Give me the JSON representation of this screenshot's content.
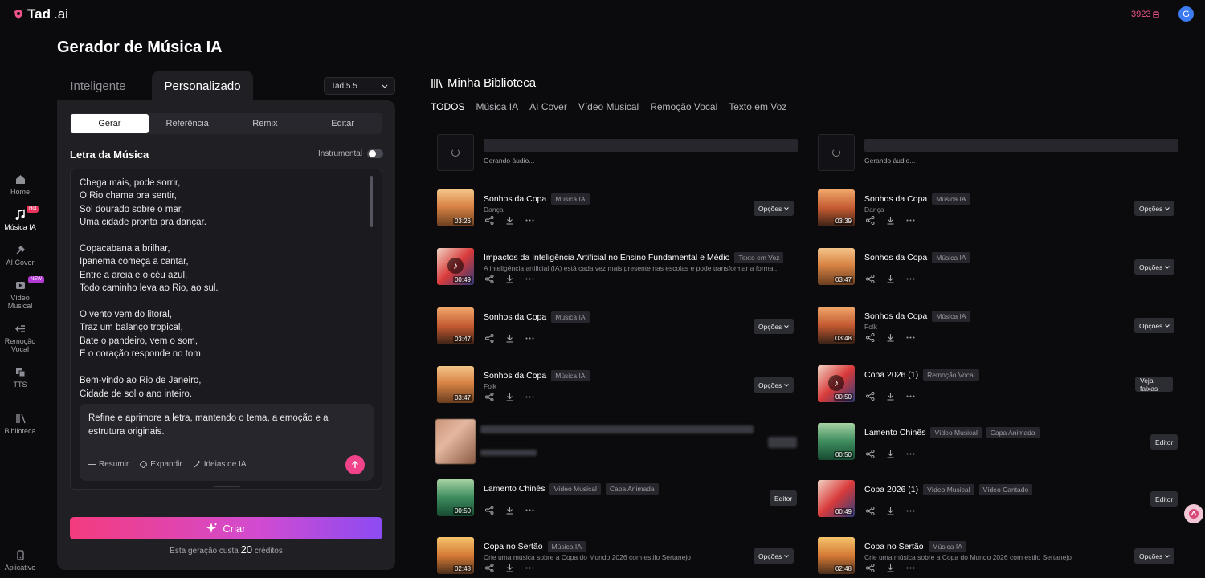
{
  "brand": {
    "name": "Tad",
    "suffix": ".ai"
  },
  "header": {
    "credits": "3923",
    "avatar_initial": "G"
  },
  "sidebar": {
    "items": [
      {
        "label": "Home",
        "icon": "home-icon"
      },
      {
        "label": "Música IA",
        "icon": "music-note-icon",
        "badge": "Hot"
      },
      {
        "label": "AI Cover",
        "icon": "ai-cover-icon"
      },
      {
        "label": "Vídeo Musical",
        "icon": "video-icon",
        "badge": "NEW"
      },
      {
        "label": "Remoção Vocal",
        "icon": "vocal-removal-icon"
      },
      {
        "label": "TTS",
        "icon": "tts-icon"
      },
      {
        "label": "Biblioteca",
        "icon": "library-icon"
      }
    ],
    "bottom": {
      "label": "Aplicativo",
      "icon": "phone-icon"
    }
  },
  "page": {
    "title": "Gerador de Música IA"
  },
  "generator": {
    "mode_tabs": [
      "Inteligente",
      "Personalizado"
    ],
    "model": "Tad 5.5",
    "sub_tabs": [
      "Gerar",
      "Referência",
      "Remix",
      "Editar"
    ],
    "lyrics_label": "Letra da Música",
    "instrumental_label": "Instrumental",
    "lyrics": "Chega mais, pode sorrir,\nO Rio chama pra sentir,\nSol dourado sobre o mar,\nUma cidade pronta pra dançar.\n\nCopacabana a brilhar,\nIpanema começa a cantar,\nEntre a areia e o céu azul,\nTodo caminho leva ao Rio, ao sul.\n\nO vento vem do litoral,\nTraz um balanço tropical,\nBate o pandeiro, vem o som,\nE o coração responde no tom.\n\nBem-vindo ao Rio de Janeiro,\nCidade de sol o ano inteiro.",
    "refine_text": "Refine e aprimore a letra, mantendo o tema, a emoção e a estrutura originais.",
    "refine_actions": [
      "Resumir",
      "Expandir",
      "Ideias de IA"
    ],
    "create_label": "Criar",
    "cost_prefix": "Esta geração custa",
    "cost_value": "20",
    "cost_suffix": "créditos"
  },
  "library": {
    "title": "Minha Biblioteca",
    "tabs": [
      "TODOS",
      "Música IA",
      "AI Cover",
      "Vídeo Musical",
      "Remoção Vocal",
      "Texto em Voz"
    ],
    "generating_text": "Gerando áudio...",
    "left": [
      {
        "title": "Sonhos da Copa",
        "tags": [
          "Música IA"
        ],
        "sub": "Dança",
        "duration": "03:26",
        "action": "Opções"
      },
      {
        "title": "Impactos da Inteligência Artificial no Ensino Fundamental e Médio",
        "tags": [
          "Texto em Voz"
        ],
        "sub": "A inteligência artificial (IA) está cada vez mais presente nas escolas e pode transformar a forma...",
        "duration": "00:49"
      },
      {
        "title": "Sonhos da Copa",
        "tags": [
          "Música IA"
        ],
        "sub": "",
        "duration": "03:47",
        "action": "Opções"
      },
      {
        "title": "Sonhos da Copa",
        "tags": [
          "Música IA"
        ],
        "sub": "Folk",
        "duration": "03:47",
        "action": "Opções"
      },
      {
        "title": "Lamento Chinês",
        "tags": [
          "Vídeo Musical",
          "Capa Animada"
        ],
        "sub": "",
        "duration": "00:50",
        "action": "Editor"
      },
      {
        "title": "Copa no Sertão",
        "tags": [
          "Música IA"
        ],
        "sub": "Crie uma música sobre a Copa do Mundo 2026 com estilo Sertanejo",
        "duration": "02:48",
        "action": "Opções"
      }
    ],
    "right": [
      {
        "title": "Sonhos da Copa",
        "tags": [
          "Música IA"
        ],
        "sub": "Dança",
        "duration": "03:39",
        "action": "Opções"
      },
      {
        "title": "Sonhos da Copa",
        "tags": [
          "Música IA"
        ],
        "sub": "",
        "duration": "03:47",
        "action": "Opções"
      },
      {
        "title": "Sonhos da Copa",
        "tags": [
          "Música IA"
        ],
        "sub": "Folk",
        "duration": "03:48",
        "action": "Opções"
      },
      {
        "title": "Copa 2026 (1)",
        "tags": [
          "Remoção Vocal"
        ],
        "sub": "",
        "duration": "00:50",
        "action": "Veja faixas"
      },
      {
        "title": "Lamento Chinês",
        "tags": [
          "Vídeo Musical",
          "Capa Animada"
        ],
        "sub": "",
        "duration": "00:50",
        "action": "Editor"
      },
      {
        "title": "Copa 2026 (1)",
        "tags": [
          "Vídeo Musical",
          "Vídeo Cantado"
        ],
        "sub": "",
        "duration": "00:49",
        "action": "Editor"
      },
      {
        "title": "Copa no Sertão",
        "tags": [
          "Música IA"
        ],
        "sub": "Crie uma música sobre a Copa do Mundo 2026 com estilo Sertanejo",
        "duration": "02:48",
        "action": "Opções"
      }
    ]
  }
}
